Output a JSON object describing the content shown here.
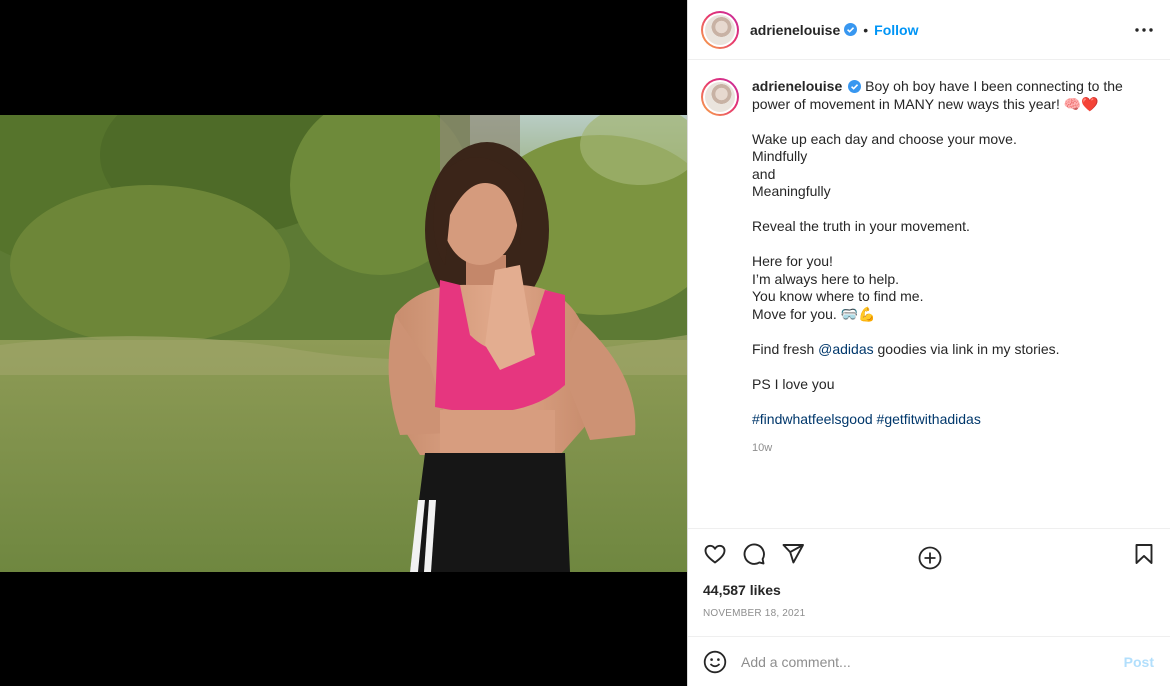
{
  "post": {
    "username": "adrienelouise",
    "follow_label": "Follow",
    "separator": "•",
    "caption_lines": [
      "Boy oh boy have I been connecting to the power of movement in MANY new ways this year! 🧠❤️",
      "Wake up each day and choose your move.",
      "Mindfully",
      "and",
      "Meaningfully",
      "Reveal the truth in your movement.",
      "Here for you!",
      "I’m always here to help.",
      "You know where to find me.",
      "Move for you. 🥽💪",
      "Find fresh",
      "@adidas",
      "goodies via link in my stories.",
      "PS I love you",
      "#findwhatfeelsgood",
      "#getfitwithadidas"
    ],
    "time_ago": "10w",
    "likes": "44,587 likes",
    "date": "NOVEMBER 18, 2021"
  },
  "comment": {
    "placeholder": "Add a comment...",
    "post_label": "Post"
  },
  "colors": {
    "accent": "#0095f6",
    "link": "#00376b",
    "post_disabled": "#b2dffc",
    "bra": "#e6367f"
  },
  "icons": [
    "verified-badge-icon",
    "more-options-icon",
    "load-more-comments-icon",
    "heart-icon",
    "comment-icon",
    "share-icon",
    "bookmark-icon",
    "emoji-icon",
    "user-tag-icon"
  ]
}
